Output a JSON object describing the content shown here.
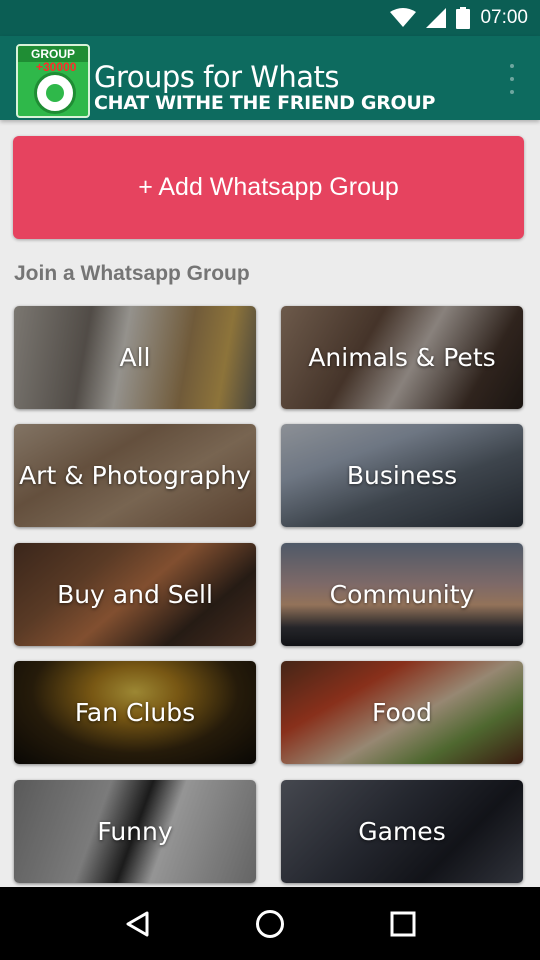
{
  "status_bar": {
    "time": "07:00",
    "icons": [
      "wifi-icon",
      "cellular-signal-icon",
      "battery-icon"
    ]
  },
  "app_bar": {
    "logo": {
      "badge_text": "GROUP",
      "count_text": "+30000"
    },
    "title": "Groups for Whats",
    "subtitle": "CHAT WITHE THE FRIEND GROUP",
    "overflow_icon": "more-vert-icon"
  },
  "actions": {
    "add_group_label": "+ Add Whatsapp Group"
  },
  "section": {
    "title": "Join a Whatsapp Group"
  },
  "categories": [
    {
      "label": "All"
    },
    {
      "label": "Animals & Pets"
    },
    {
      "label": "Art & Photography"
    },
    {
      "label": "Business"
    },
    {
      "label": "Buy and Sell"
    },
    {
      "label": "Community"
    },
    {
      "label": "Fan Clubs"
    },
    {
      "label": "Food"
    },
    {
      "label": "Funny"
    },
    {
      "label": "Games"
    }
  ],
  "nav_bar": {
    "buttons": [
      "back-icon",
      "home-icon",
      "recents-icon"
    ]
  },
  "colors": {
    "status_bar": "#0b5e54",
    "app_bar": "#0d6b5f",
    "accent_button": "#e6435f",
    "background": "#ececec",
    "section_title": "#757575"
  }
}
